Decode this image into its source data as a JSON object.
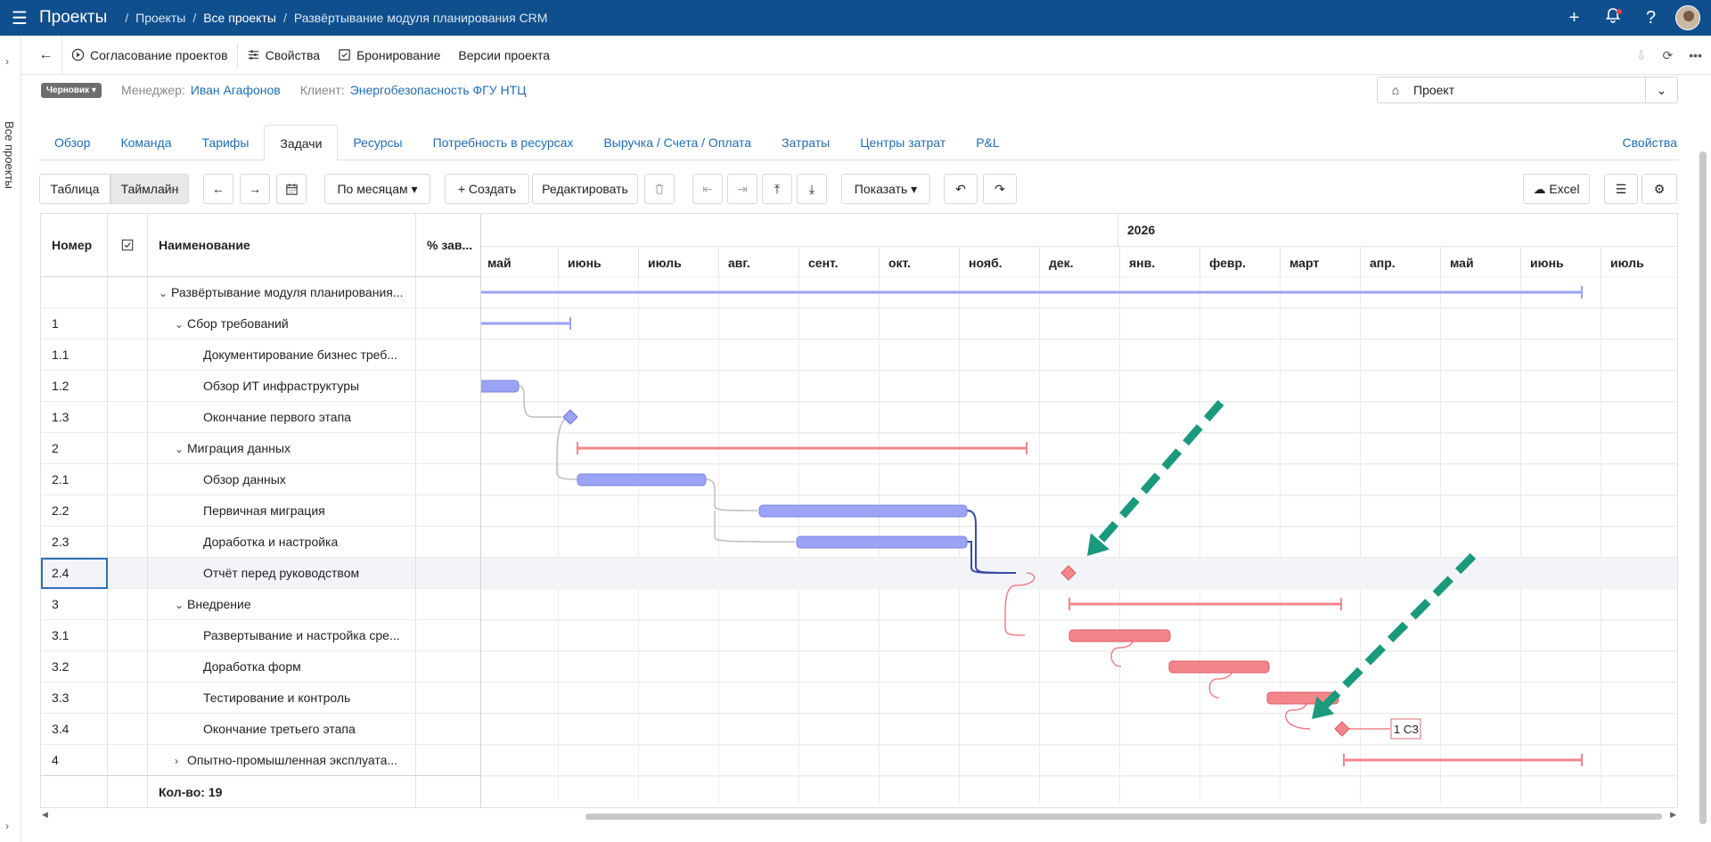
{
  "topbar": {
    "app_title": "Проекты",
    "crumbs": [
      "Проекты",
      "Все проекты",
      "Развёртывание модуля планирования CRM"
    ],
    "sep": "/",
    "menu_icon": "☰",
    "plus_icon": "+",
    "help_icon": "?"
  },
  "sidestrip": {
    "label": "Все проекты"
  },
  "toolbar": {
    "items": [
      "Согласование проектов",
      "Свойства",
      "Бронирование",
      "Версии проекта"
    ]
  },
  "meta": {
    "status": "Черновик",
    "manager_label": "Менеджер:",
    "manager": "Иван Агафонов",
    "client_label": "Клиент:",
    "client": "Энергобезопасность ФГУ НТЦ",
    "selector": "Проект"
  },
  "tabs": {
    "items": [
      "Обзор",
      "Команда",
      "Тарифы",
      "Задачи",
      "Ресурсы",
      "Потребность в ресурсах",
      "Выручка / Счета / Оплата",
      "Затраты",
      "Центры затрат",
      "P&L"
    ],
    "active": "Задачи",
    "right": "Свойства"
  },
  "actions": {
    "view_table": "Таблица",
    "view_timeline": "Таймлайн",
    "scale": "По месяцам",
    "create": "Создать",
    "edit": "Редактировать",
    "show": "Показать",
    "excel": "Excel"
  },
  "table": {
    "headers": {
      "num": "Номер",
      "name": "Наименование",
      "pct": "% зав..."
    },
    "rows": [
      {
        "num": "",
        "name": "Развёртывание модуля планирования...",
        "level": 0,
        "expander": "open"
      },
      {
        "num": "1",
        "name": "Сбор требований",
        "level": 1,
        "expander": "open"
      },
      {
        "num": "1.1",
        "name": "Документирование бизнес треб...",
        "level": 2,
        "expander": ""
      },
      {
        "num": "1.2",
        "name": "Обзор ИТ инфраструктуры",
        "level": 2,
        "expander": ""
      },
      {
        "num": "1.3",
        "name": "Окончание первого этапа",
        "level": 2,
        "expander": ""
      },
      {
        "num": "2",
        "name": "Миграция данных",
        "level": 1,
        "expander": "open"
      },
      {
        "num": "2.1",
        "name": "Обзор данных",
        "level": 2,
        "expander": ""
      },
      {
        "num": "2.2",
        "name": "Первичная миграция",
        "level": 2,
        "expander": ""
      },
      {
        "num": "2.3",
        "name": "Доработка и настройка",
        "level": 2,
        "expander": ""
      },
      {
        "num": "2.4",
        "name": "Отчёт перед руководством",
        "level": 2,
        "expander": "",
        "selected": true
      },
      {
        "num": "3",
        "name": "Внедрение",
        "level": 1,
        "expander": "open"
      },
      {
        "num": "3.1",
        "name": "Развертывание и настройка сре...",
        "level": 2,
        "expander": ""
      },
      {
        "num": "3.2",
        "name": "Доработка форм",
        "level": 2,
        "expander": ""
      },
      {
        "num": "3.3",
        "name": "Тестирование и контроль",
        "level": 2,
        "expander": ""
      },
      {
        "num": "3.4",
        "name": "Окончание третьего этапа",
        "level": 2,
        "expander": ""
      },
      {
        "num": "4",
        "name": "Опытно-промышленная эксплуата...",
        "level": 1,
        "expander": "closed"
      }
    ],
    "footer": "Кол-во: 19"
  },
  "timeline": {
    "year": "2026",
    "months": [
      "май",
      "июнь",
      "июль",
      "авг.",
      "сент.",
      "окт.",
      "нояб.",
      "дек.",
      "янв.",
      "февр.",
      "март",
      "апр.",
      "май",
      "июнь",
      "июль"
    ],
    "milestone_label": "1 СЗ",
    "colors": {
      "blue": "#9aa3f5",
      "red": "#f4868b",
      "dark_link": "#3a4aa8",
      "accent": "#1a9a7c"
    }
  }
}
